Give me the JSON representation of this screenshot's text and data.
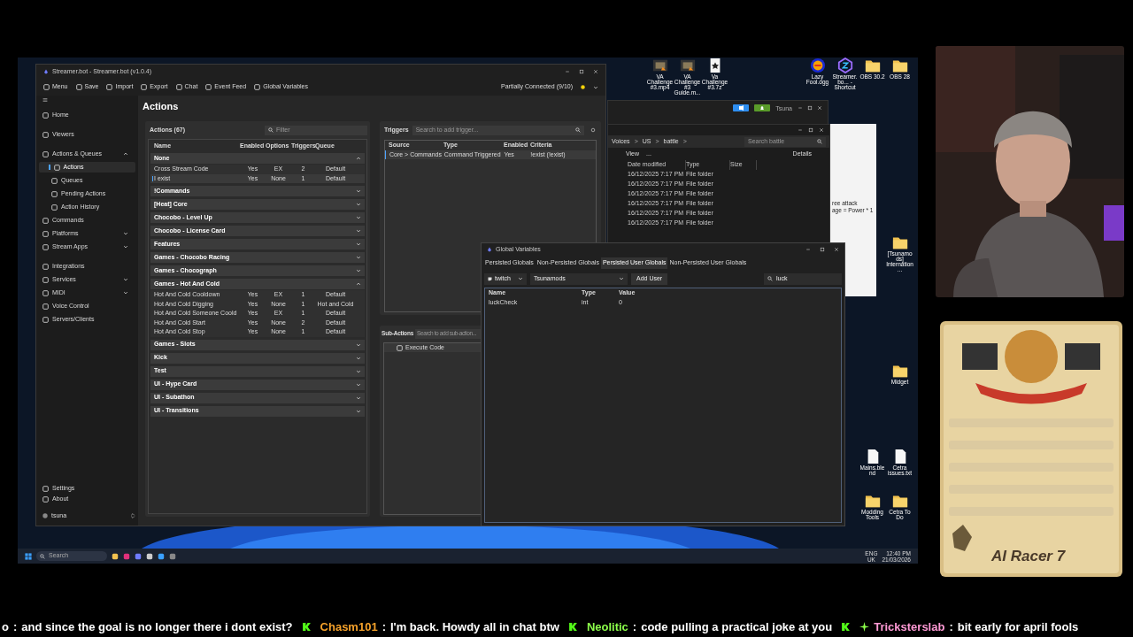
{
  "streamerbot": {
    "title": "Streamer.bot - Streamer.bot (v1.0.4)",
    "toolbar": [
      "Menu",
      "Save",
      "Import",
      "Export",
      "Chat",
      "Event Feed",
      "Global Variables"
    ],
    "status": "Partially Connected (9/10)",
    "sidebar": [
      {
        "label": "Home",
        "selected": false
      },
      {
        "label": "Viewers",
        "selected": false
      },
      {
        "label": "Actions & Queues",
        "selected": false,
        "expanded": true,
        "children": [
          {
            "label": "Actions",
            "selected": true
          },
          {
            "label": "Queues",
            "selected": false
          },
          {
            "label": "Pending Actions",
            "selected": false
          },
          {
            "label": "Action History",
            "selected": false
          }
        ]
      },
      {
        "label": "Commands",
        "selected": false
      },
      {
        "label": "Platforms",
        "selected": false,
        "expanded": false
      },
      {
        "label": "Stream Apps",
        "selected": false,
        "expanded": false
      },
      {
        "label": "Integrations",
        "selected": false
      },
      {
        "label": "Services",
        "selected": false,
        "expanded": false
      },
      {
        "label": "MIDI",
        "selected": false,
        "expanded": false
      },
      {
        "label": "Voice Control",
        "selected": false
      },
      {
        "label": "Servers/Clients",
        "selected": false
      }
    ],
    "sidebar_footer": [
      "Settings",
      "About"
    ],
    "user": "tsuna",
    "page_title": "Actions",
    "actions": {
      "title": "Actions (67)",
      "filter_placeholder": "Filter",
      "columns": [
        "Name",
        "Enabled",
        "Options",
        "Triggers",
        "Queue"
      ],
      "groups": [
        {
          "name": "None",
          "expanded": true,
          "actions": [
            {
              "name": "Cross Stream Code",
              "enabled": "Yes",
              "options": "EX",
              "triggers": "2",
              "queue": "Default",
              "selected": false
            },
            {
              "name": "I exist",
              "enabled": "Yes",
              "options": "None",
              "triggers": "1",
              "queue": "Default",
              "selected": true
            }
          ]
        },
        {
          "name": "!Commands",
          "expanded": false
        },
        {
          "name": "[Heat] Core",
          "expanded": false
        },
        {
          "name": "Chocobo - Level Up",
          "expanded": false
        },
        {
          "name": "Chocobo - License Card",
          "expanded": false
        },
        {
          "name": "Features",
          "expanded": false
        },
        {
          "name": "Games - Chocobo Racing",
          "expanded": false
        },
        {
          "name": "Games - Chocograph",
          "expanded": false
        },
        {
          "name": "Games - Hot And Cold",
          "expanded": true,
          "actions": [
            {
              "name": "Hot And Cold Cooldown",
              "enabled": "Yes",
              "options": "EX",
              "triggers": "1",
              "queue": "Default",
              "selected": false
            },
            {
              "name": "Hot And Cold Digging",
              "enabled": "Yes",
              "options": "None",
              "triggers": "1",
              "queue": "Hot and Cold",
              "selected": false
            },
            {
              "name": "Hot And Cold Someone Coold",
              "enabled": "Yes",
              "options": "EX",
              "triggers": "1",
              "queue": "Default",
              "selected": false
            },
            {
              "name": "Hot And Cold Start",
              "enabled": "Yes",
              "options": "None",
              "triggers": "2",
              "queue": "Default",
              "selected": false
            },
            {
              "name": "Hot And Cold Stop",
              "enabled": "Yes",
              "options": "None",
              "triggers": "1",
              "queue": "Default",
              "selected": false
            }
          ]
        },
        {
          "name": "Games - Slots",
          "expanded": false
        },
        {
          "name": "Kick",
          "expanded": false
        },
        {
          "name": "Test",
          "expanded": false
        },
        {
          "name": "UI - Hype Card",
          "expanded": false
        },
        {
          "name": "UI - Subathon",
          "expanded": false
        },
        {
          "name": "UI - Transitions",
          "expanded": false
        }
      ]
    },
    "triggers": {
      "title": "Triggers",
      "placeholder": "Search to add trigger...",
      "columns": [
        "Source",
        "Type",
        "Enabled",
        "Criteria"
      ],
      "rows": [
        {
          "source": "Core > Commands",
          "type": "Command Triggered",
          "enabled": "Yes",
          "criteria": "!exist (!exist)",
          "selected": true
        }
      ]
    },
    "sub_actions": {
      "title": "Sub-Actions",
      "placeholder": "Search to add sub-action...",
      "items": [
        "Execute Code"
      ]
    }
  },
  "global_variables": {
    "title": "Global Variables",
    "tabs": [
      {
        "label": "Persisted Globals",
        "selected": false
      },
      {
        "label": "Non-Persisted Globals",
        "selected": false
      },
      {
        "label": "Persisted User Globals",
        "selected": true
      },
      {
        "label": "Non-Persisted User Globals",
        "selected": false
      }
    ],
    "platform": "twitch",
    "user": "Tsunamods",
    "add_user": "Add User",
    "search": "luck",
    "columns": [
      "Name",
      "Type",
      "Value"
    ],
    "rows": [
      [
        "luckCheck",
        "int",
        "0"
      ]
    ]
  },
  "explorer": {
    "breadcrumb": [
      {
        "label": "Voices",
        "separator": ">"
      },
      {
        "label": "US",
        "separator": ">"
      },
      {
        "label": "battle",
        "separator": ">"
      }
    ],
    "search_placeholder": "Search battle",
    "view": "View",
    "more": "...",
    "details": "Details",
    "columns": [
      "Date modified",
      "Type",
      "Size"
    ],
    "rows": [
      [
        "16/12/2025 7:17 PM",
        "File folder"
      ],
      [
        "16/12/2025 7:17 PM",
        "File folder"
      ],
      [
        "16/12/2025 7:17 PM",
        "File folder"
      ],
      [
        "16/12/2025 7:17 PM",
        "File folder"
      ],
      [
        "16/12/2025 7:17 PM",
        "File folder"
      ],
      [
        "16/12/2025 7:17 PM",
        "File folder"
      ]
    ]
  },
  "chat_window": {
    "user": "Tsuna"
  },
  "note_window": {
    "lines": [
      "ree attack",
      "age = Power * 1"
    ]
  },
  "desktop_icons": [
    {
      "label": "VA Challenge #3.mp4",
      "kind": "video"
    },
    {
      "label": "VA Challenge #3 Guide.m...",
      "kind": "video"
    },
    {
      "label": "Va Challenge #3.7z",
      "kind": "archive"
    },
    {
      "label": "Lazy Fool.ogg",
      "kind": "audio"
    },
    {
      "label": "Streamer.bo... - Shortcut",
      "kind": "app"
    },
    {
      "label": "OBS 30.2",
      "kind": "folder"
    },
    {
      "label": "OBS 28",
      "kind": "folder"
    },
    {
      "label": "[Tsunamods] Internation...",
      "kind": "folder"
    },
    {
      "label": "Midget",
      "kind": "folder"
    },
    {
      "label": "Mains.blend",
      "kind": "file"
    },
    {
      "label": "Cetra issues.txt",
      "kind": "file"
    },
    {
      "label": "Modding Tools",
      "kind": "folder"
    },
    {
      "label": "Cetra To Do",
      "kind": "folder"
    }
  ],
  "taskbar": {
    "search_placeholder": "Search",
    "language": "ENG",
    "region": "UK",
    "time": "12:40 PM",
    "date": "21/03/2026"
  },
  "overlay_card": {
    "title": "AI Racer 7"
  },
  "ticker": [
    {
      "user": "o",
      "separator": ":",
      "color": "#ffffff",
      "message": "and since the goal is no longer there i dont exist?",
      "sparkle": false
    },
    {
      "user": "Chasm101",
      "separator": ":",
      "color": "#f5a12a",
      "message": "I'm back. Howdy all in chat btw",
      "sparkle": false
    },
    {
      "user": "Neolitic",
      "separator": ":",
      "color": "#8cff4a",
      "message": "code pulling a practical joke at you",
      "sparkle": false
    },
    {
      "user": "Tricksterslab",
      "separator": ":",
      "color": "#ff9ad5",
      "message": "bit early for april fools",
      "sparkle": true
    }
  ]
}
